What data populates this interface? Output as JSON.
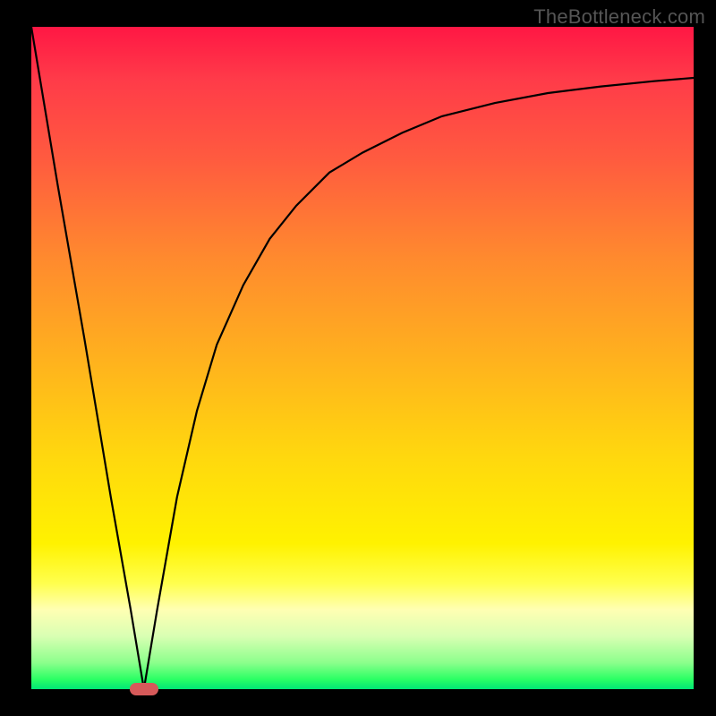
{
  "watermark": "TheBottleneck.com",
  "colors": {
    "frame": "#000000",
    "curve": "#000000",
    "marker": "#d65a5a",
    "gradient_top": "#ff1744",
    "gradient_bottom": "#00e676"
  },
  "chart_data": {
    "type": "line",
    "title": "",
    "xlabel": "",
    "ylabel": "",
    "xlim": [
      0,
      100
    ],
    "ylim": [
      0,
      100
    ],
    "grid": false,
    "legend": false,
    "annotations": [],
    "marker": {
      "x": 17,
      "y": 0,
      "shape": "rounded-rect"
    },
    "series": [
      {
        "name": "bottleneck-curve",
        "x": [
          0,
          4,
          8,
          12,
          15,
          17,
          19,
          22,
          25,
          28,
          32,
          36,
          40,
          45,
          50,
          56,
          62,
          70,
          78,
          86,
          94,
          100
        ],
        "values": [
          100,
          76,
          53,
          29,
          12,
          0,
          12,
          29,
          42,
          52,
          61,
          68,
          73,
          78,
          81,
          84,
          86.5,
          88.5,
          90,
          91,
          91.8,
          92.3
        ]
      }
    ]
  }
}
